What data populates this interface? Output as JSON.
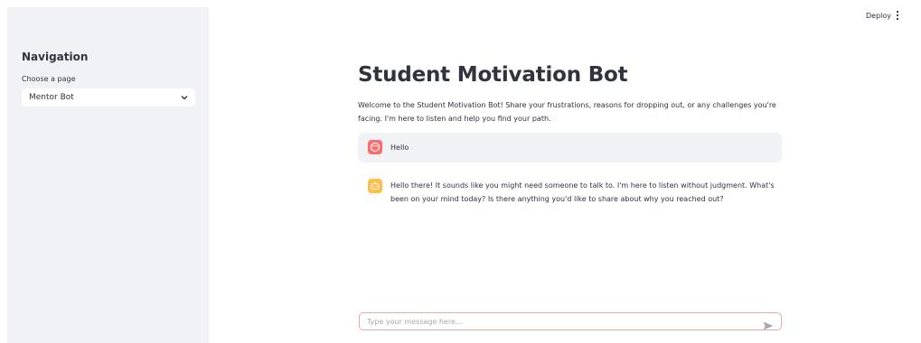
{
  "sidebar": {
    "title": "Navigation",
    "select_label": "Choose a page",
    "selected_page": "Mentor Bot"
  },
  "header": {
    "deploy_label": "Deploy",
    "menu_icon": "vertical-ellipsis-icon"
  },
  "main": {
    "title": "Student Motivation Bot",
    "intro": "Welcome to the Student Motivation Bot! Share your frustrations, reasons for dropping out, or any challenges you're facing. I'm here to listen and help you find your path.",
    "messages": [
      {
        "role": "user",
        "avatar_icon": "user-face-icon",
        "avatar_color": "#ff6b6b",
        "text": "Hello"
      },
      {
        "role": "assistant",
        "avatar_icon": "bot-icon",
        "avatar_color": "#ffbd45",
        "text": "Hello there! It sounds like you might need someone to talk to. I'm here to listen without judgment. What's been on your mind today? Is there anything you'd like to share about why you reached out?"
      }
    ]
  },
  "chat_input": {
    "placeholder": "Type your message here...",
    "value": "",
    "send_icon": "send-arrow-icon"
  },
  "colors": {
    "sidebar_bg": "#f0f2f6",
    "text": "#31333f",
    "user_avatar": "#ff6b6b",
    "bot_avatar": "#ffbd45",
    "input_border": "#f2a7a7"
  }
}
